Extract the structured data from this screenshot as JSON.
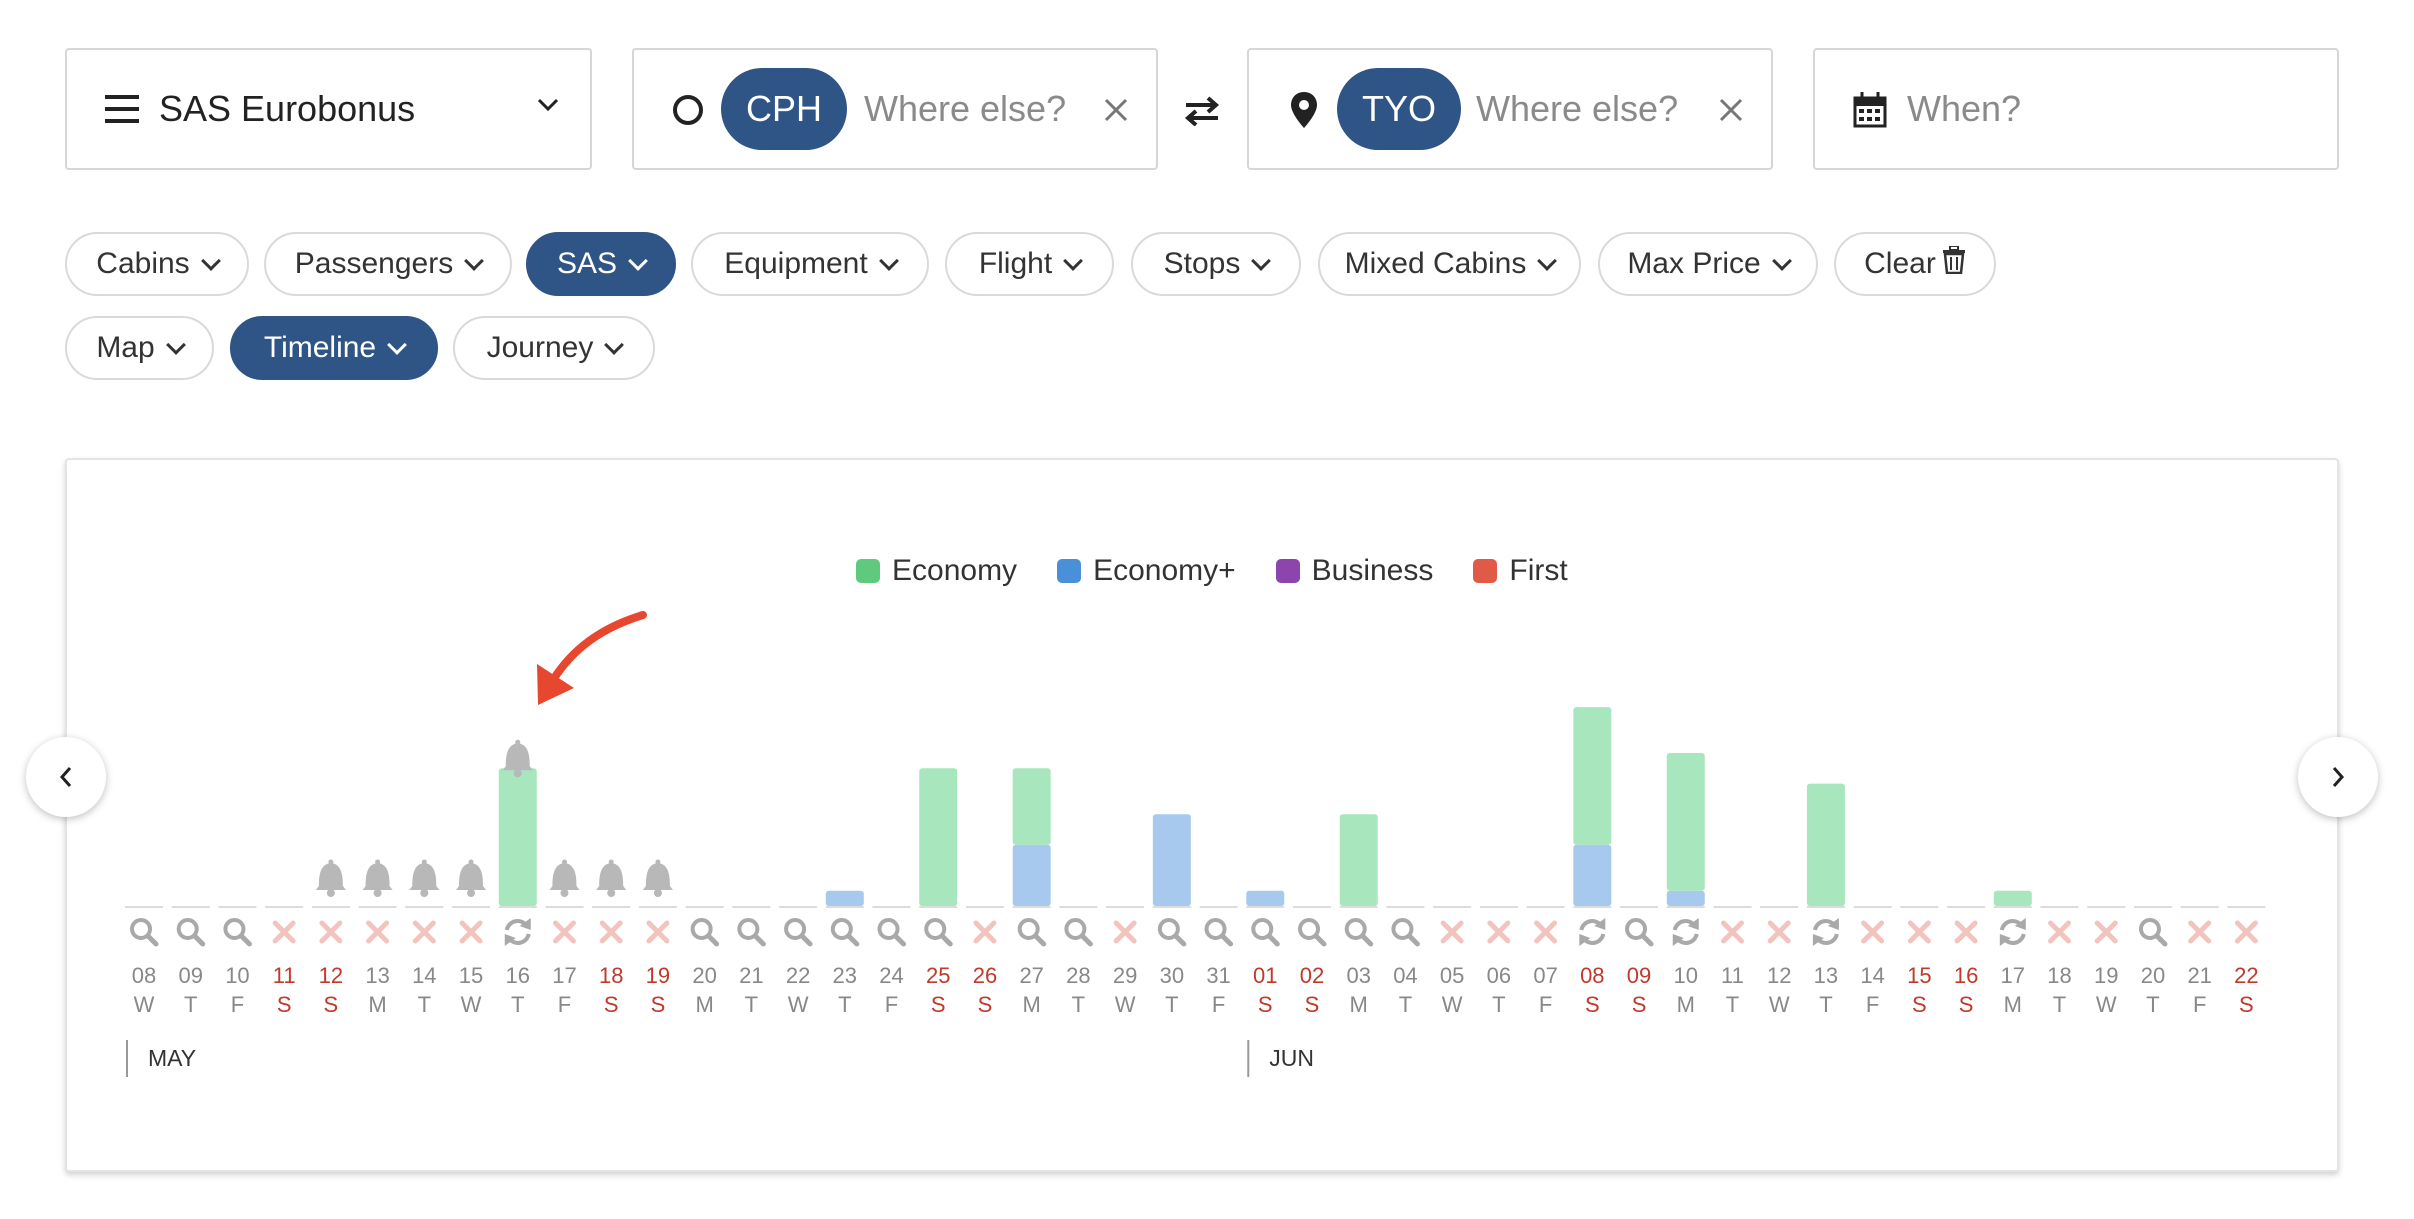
{
  "search": {
    "program": "SAS Eurobonus",
    "origin": {
      "code": "CPH",
      "placeholder": "Where else?"
    },
    "destination": {
      "code": "TYO",
      "placeholder": "Where else?"
    },
    "when_placeholder": "When?"
  },
  "filters": {
    "row1": [
      {
        "label": "Cabins",
        "active": false
      },
      {
        "label": "Passengers",
        "active": false
      },
      {
        "label": "SAS",
        "active": true
      },
      {
        "label": "Equipment",
        "active": false
      },
      {
        "label": "Flight",
        "active": false
      },
      {
        "label": "Stops",
        "active": false
      },
      {
        "label": "Mixed Cabins",
        "active": false
      },
      {
        "label": "Max Price",
        "active": false
      }
    ],
    "clear_label": "Clear",
    "row2": [
      {
        "label": "Map",
        "active": false
      },
      {
        "label": "Timeline",
        "active": true
      },
      {
        "label": "Journey",
        "active": false
      }
    ]
  },
  "colors": {
    "economy": "#a8e6bd",
    "economy_plus": "#a7c9ee",
    "business": "#8e44ad",
    "first": "#e05a47",
    "weekend_text": "#c0392b",
    "accent": "#2f5486"
  },
  "chart_data": {
    "type": "bar",
    "legend": [
      {
        "name": "Economy",
        "color": "#5fc97e"
      },
      {
        "name": "Economy+",
        "color": "#4a90d9"
      },
      {
        "name": "Business",
        "color": "#8e44ad"
      },
      {
        "name": "First",
        "color": "#e05a47"
      }
    ],
    "months": [
      {
        "label": "MAY",
        "start_index": 0
      },
      {
        "label": "JUN",
        "start_index": 24
      }
    ],
    "days": [
      {
        "d": "08",
        "w": "W",
        "weekend": false,
        "status": "search",
        "bell": false,
        "economy": 0,
        "economy_plus": 0
      },
      {
        "d": "09",
        "w": "T",
        "weekend": false,
        "status": "search",
        "bell": false,
        "economy": 0,
        "economy_plus": 0
      },
      {
        "d": "10",
        "w": "F",
        "weekend": false,
        "status": "search",
        "bell": false,
        "economy": 0,
        "economy_plus": 0
      },
      {
        "d": "11",
        "w": "S",
        "weekend": true,
        "status": "none",
        "bell": false,
        "economy": 0,
        "economy_plus": 0
      },
      {
        "d": "12",
        "w": "S",
        "weekend": true,
        "status": "none",
        "bell": true,
        "economy": 0,
        "economy_plus": 0
      },
      {
        "d": "13",
        "w": "M",
        "weekend": false,
        "status": "none",
        "bell": true,
        "economy": 0,
        "economy_plus": 0
      },
      {
        "d": "14",
        "w": "T",
        "weekend": false,
        "status": "none",
        "bell": true,
        "economy": 0,
        "economy_plus": 0
      },
      {
        "d": "15",
        "w": "W",
        "weekend": false,
        "status": "none",
        "bell": true,
        "economy": 0,
        "economy_plus": 0
      },
      {
        "d": "16",
        "w": "T",
        "weekend": false,
        "status": "refresh",
        "bell": true,
        "economy": 9,
        "economy_plus": 0,
        "arrow": true
      },
      {
        "d": "17",
        "w": "F",
        "weekend": false,
        "status": "none",
        "bell": true,
        "economy": 0,
        "economy_plus": 0
      },
      {
        "d": "18",
        "w": "S",
        "weekend": true,
        "status": "none",
        "bell": true,
        "economy": 0,
        "economy_plus": 0
      },
      {
        "d": "19",
        "w": "S",
        "weekend": true,
        "status": "none",
        "bell": true,
        "economy": 0,
        "economy_plus": 0
      },
      {
        "d": "20",
        "w": "M",
        "weekend": false,
        "status": "search",
        "bell": false,
        "economy": 0,
        "economy_plus": 0
      },
      {
        "d": "21",
        "w": "T",
        "weekend": false,
        "status": "search",
        "bell": false,
        "economy": 0,
        "economy_plus": 0
      },
      {
        "d": "22",
        "w": "W",
        "weekend": false,
        "status": "search",
        "bell": false,
        "economy": 0,
        "economy_plus": 0
      },
      {
        "d": "23",
        "w": "T",
        "weekend": false,
        "status": "search",
        "bell": false,
        "economy": 0,
        "economy_plus": 1
      },
      {
        "d": "24",
        "w": "F",
        "weekend": false,
        "status": "search",
        "bell": false,
        "economy": 0,
        "economy_plus": 0
      },
      {
        "d": "25",
        "w": "S",
        "weekend": true,
        "status": "search",
        "bell": false,
        "economy": 9,
        "economy_plus": 0
      },
      {
        "d": "26",
        "w": "S",
        "weekend": true,
        "status": "none",
        "bell": false,
        "economy": 0,
        "economy_plus": 0
      },
      {
        "d": "27",
        "w": "M",
        "weekend": false,
        "status": "search",
        "bell": false,
        "economy": 5,
        "economy_plus": 4
      },
      {
        "d": "28",
        "w": "T",
        "weekend": false,
        "status": "search",
        "bell": false,
        "economy": 0,
        "economy_plus": 0
      },
      {
        "d": "29",
        "w": "W",
        "weekend": false,
        "status": "none",
        "bell": false,
        "economy": 0,
        "economy_plus": 0
      },
      {
        "d": "30",
        "w": "T",
        "weekend": false,
        "status": "search",
        "bell": false,
        "economy": 0,
        "economy_plus": 6
      },
      {
        "d": "31",
        "w": "F",
        "weekend": false,
        "status": "search",
        "bell": false,
        "economy": 0,
        "economy_plus": 0
      },
      {
        "d": "01",
        "w": "S",
        "weekend": true,
        "status": "search",
        "bell": false,
        "economy": 0,
        "economy_plus": 1
      },
      {
        "d": "02",
        "w": "S",
        "weekend": true,
        "status": "search",
        "bell": false,
        "economy": 0,
        "economy_plus": 0
      },
      {
        "d": "03",
        "w": "M",
        "weekend": false,
        "status": "search",
        "bell": false,
        "economy": 6,
        "economy_plus": 0
      },
      {
        "d": "04",
        "w": "T",
        "weekend": false,
        "status": "search",
        "bell": false,
        "economy": 0,
        "economy_plus": 0
      },
      {
        "d": "05",
        "w": "W",
        "weekend": false,
        "status": "none",
        "bell": false,
        "economy": 0,
        "economy_plus": 0
      },
      {
        "d": "06",
        "w": "T",
        "weekend": false,
        "status": "none",
        "bell": false,
        "economy": 0,
        "economy_plus": 0
      },
      {
        "d": "07",
        "w": "F",
        "weekend": false,
        "status": "none",
        "bell": false,
        "economy": 0,
        "economy_plus": 0
      },
      {
        "d": "08",
        "w": "S",
        "weekend": true,
        "status": "refresh",
        "bell": false,
        "economy": 9,
        "economy_plus": 4
      },
      {
        "d": "09",
        "w": "S",
        "weekend": true,
        "status": "search",
        "bell": false,
        "economy": 0,
        "economy_plus": 0
      },
      {
        "d": "10",
        "w": "M",
        "weekend": false,
        "status": "refresh",
        "bell": false,
        "economy": 9,
        "economy_plus": 1
      },
      {
        "d": "11",
        "w": "T",
        "weekend": false,
        "status": "none",
        "bell": false,
        "economy": 0,
        "economy_plus": 0
      },
      {
        "d": "12",
        "w": "W",
        "weekend": false,
        "status": "none",
        "bell": false,
        "economy": 0,
        "economy_plus": 0
      },
      {
        "d": "13",
        "w": "T",
        "weekend": false,
        "status": "refresh",
        "bell": false,
        "economy": 8,
        "economy_plus": 0
      },
      {
        "d": "14",
        "w": "F",
        "weekend": false,
        "status": "none",
        "bell": false,
        "economy": 0,
        "economy_plus": 0
      },
      {
        "d": "15",
        "w": "S",
        "weekend": true,
        "status": "none",
        "bell": false,
        "economy": 0,
        "economy_plus": 0
      },
      {
        "d": "16",
        "w": "S",
        "weekend": true,
        "status": "none",
        "bell": false,
        "economy": 0,
        "economy_plus": 0
      },
      {
        "d": "17",
        "w": "M",
        "weekend": false,
        "status": "refresh",
        "bell": false,
        "economy": 1,
        "economy_plus": 0
      },
      {
        "d": "18",
        "w": "T",
        "weekend": false,
        "status": "none",
        "bell": false,
        "economy": 0,
        "economy_plus": 0
      },
      {
        "d": "19",
        "w": "W",
        "weekend": false,
        "status": "none",
        "bell": false,
        "economy": 0,
        "economy_plus": 0
      },
      {
        "d": "20",
        "w": "T",
        "weekend": false,
        "status": "search",
        "bell": false,
        "economy": 0,
        "economy_plus": 0
      },
      {
        "d": "21",
        "w": "F",
        "weekend": false,
        "status": "none",
        "bell": false,
        "economy": 0,
        "economy_plus": 0
      },
      {
        "d": "22",
        "w": "S",
        "weekend": true,
        "status": "none",
        "bell": false,
        "economy": 0,
        "economy_plus": 0
      }
    ]
  }
}
